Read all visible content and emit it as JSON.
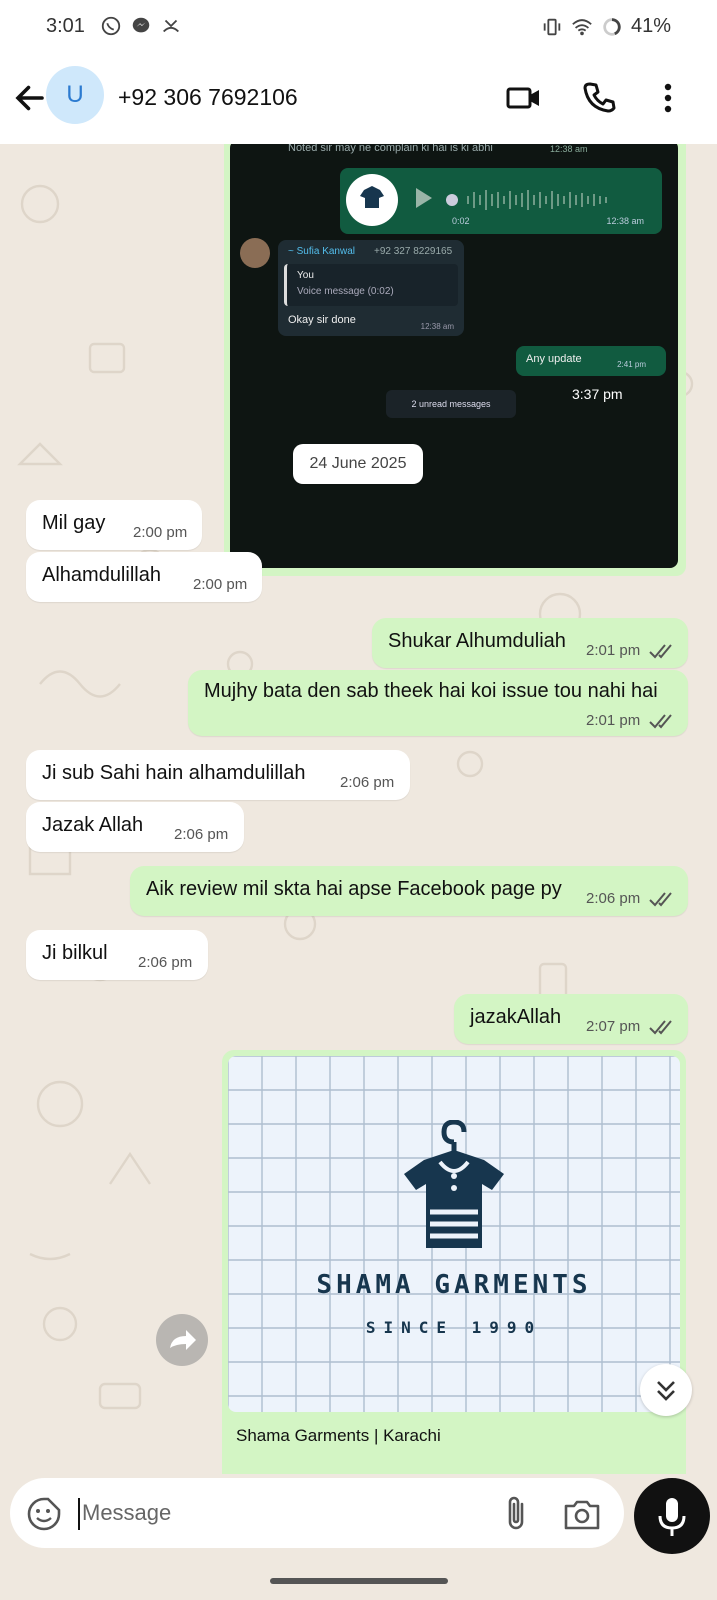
{
  "status_bar": {
    "time": "3:01",
    "battery": "41%",
    "left_icons": [
      "whatsapp-icon",
      "messenger-icon",
      "missed-call-icon"
    ],
    "right_icons": [
      "vibrate-icon",
      "wifi-icon",
      "battery-ring-icon"
    ]
  },
  "header": {
    "avatar_letter": "U",
    "contact": "+92 306 7692106",
    "icons": [
      "back-arrow-icon",
      "video-call-icon",
      "phone-icon",
      "more-vert-icon"
    ]
  },
  "embedded_screenshot": {
    "sent_partial_text": "Noted sir may ne complain ki hai is ki abhi",
    "sent_partial_time": "12:38 am",
    "voice_logo": "SHAMA GARMENTS",
    "voice_duration": "0:02",
    "voice_time": "12:38 am",
    "incoming_name": "~ Sufia Kanwal",
    "incoming_phone": "+92 327 8229165",
    "quote_author": "You",
    "quote_text": "Voice message (0:02)",
    "incoming_text": "Okay sir done",
    "incoming_time": "12:38 am",
    "update_text": "Any update",
    "update_time": "2:41 pm",
    "unread": "2 unread messages",
    "screenshot_time": "3:37 pm"
  },
  "date_chip": "24 June 2025",
  "messages": [
    {
      "dir": "in",
      "text": "Mil gay",
      "time": "2:00 pm"
    },
    {
      "dir": "in",
      "text": "Alhamdulillah",
      "time": "2:00 pm"
    },
    {
      "dir": "out",
      "text": "Shukar Alhumduliah",
      "time": "2:01 pm"
    },
    {
      "dir": "out",
      "text": "Mujhy bata den sab theek hai koi issue tou nahi hai",
      "time": "2:01 pm"
    },
    {
      "dir": "in",
      "text": "Ji sub Sahi hain alhamdulillah",
      "time": "2:06 pm"
    },
    {
      "dir": "in",
      "text": "Jazak Allah",
      "time": "2:06 pm"
    },
    {
      "dir": "out",
      "text": "Aik review mil skta hai apse Facebook page py",
      "time": "2:06 pm"
    },
    {
      "dir": "in",
      "text": "Ji bilkul",
      "time": "2:06 pm"
    },
    {
      "dir": "out",
      "text": "jazakAllah",
      "time": "2:07 pm"
    }
  ],
  "link_preview": {
    "brand": "SHAMA GARMENTS",
    "since": "SINCE 1990",
    "title": "Shama Garments | Karachi"
  },
  "input": {
    "placeholder": "Message",
    "icons": [
      "sticker-icon",
      "attach-icon",
      "camera-icon",
      "mic-icon"
    ]
  },
  "colors": {
    "chat_bg": "#efe8df",
    "outgoing_bubble": "#d3f5c4",
    "incoming_bubble": "#ffffff",
    "read_ticks": "#555555",
    "link_blue": "#53bdeb"
  }
}
